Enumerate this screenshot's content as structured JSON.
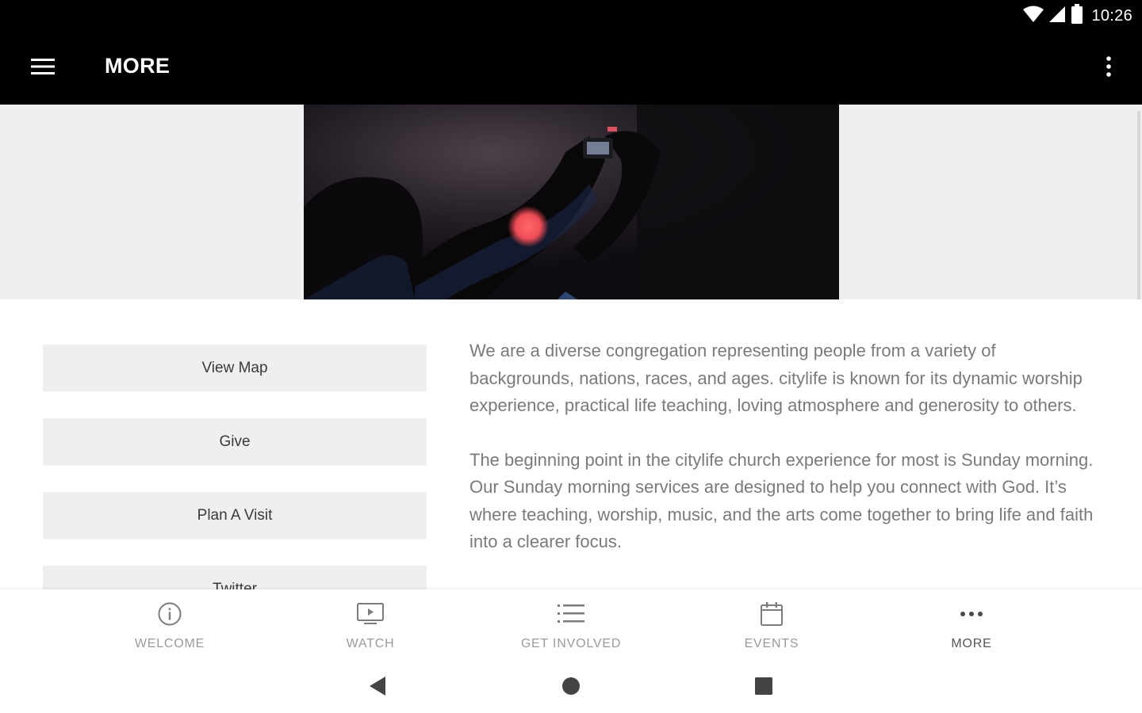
{
  "status_bar": {
    "time": "10:26",
    "icons": [
      "wifi-icon",
      "cell-signal-icon",
      "battery-icon"
    ]
  },
  "app_bar": {
    "title": "MORE",
    "menu_icon": "hamburger-menu-icon",
    "overflow_icon": "more-vert-icon"
  },
  "colors": {
    "app_bar_bg": "#000000",
    "hero_band_bg": "#eeeff0",
    "button_bg": "#eeeff0",
    "body_text": "#7a7a7a",
    "nav_label": "#9a9a9a",
    "nav_label_active": "#555555"
  },
  "actions": [
    {
      "label": "View Map"
    },
    {
      "label": "Give"
    },
    {
      "label": "Plan A Visit"
    },
    {
      "label": "Twitter"
    }
  ],
  "description": {
    "paragraph_1": "We are a diverse congregation representing people from a variety of backgrounds, nations, races, and ages. citylife is known for its dynamic worship experience, practical life teaching, loving atmosphere and generosity to others.",
    "paragraph_2": "The beginning point in the citylife church experience for most is Sunday morning. Our Sunday morning services are designed to help you connect with God. It’s where teaching, worship, music, and the arts come together to bring life and faith into a clearer focus."
  },
  "bottom_nav": [
    {
      "label": "WELCOME",
      "icon": "info-icon"
    },
    {
      "label": "WATCH",
      "icon": "video-icon"
    },
    {
      "label": "GET INVOLVED",
      "icon": "list-icon"
    },
    {
      "label": "EVENTS",
      "icon": "calendar-icon"
    },
    {
      "label": "MORE",
      "icon": "more-horiz-icon",
      "active": true
    }
  ],
  "system_nav": [
    "back-icon",
    "home-icon",
    "recents-icon"
  ]
}
